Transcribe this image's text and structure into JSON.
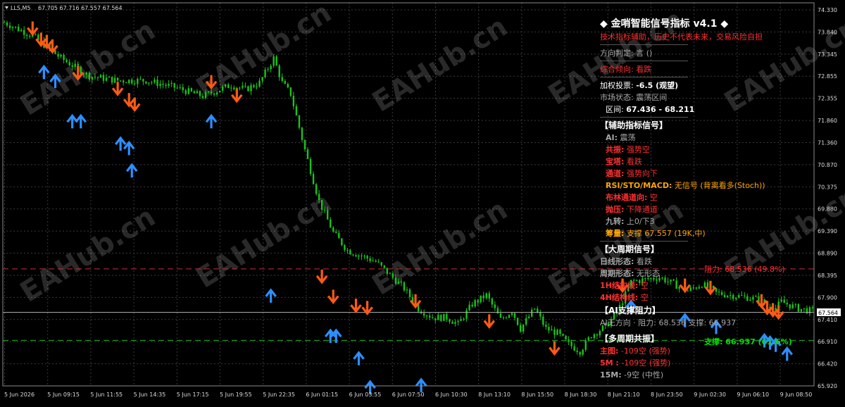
{
  "header": {
    "symbol": "LLS,M5",
    "ohlc": "67.705 67.716 67.557 67.564"
  },
  "price_axis": {
    "ticks": [
      "74.330",
      "73.840",
      "73.345",
      "72.855",
      "72.355",
      "71.860",
      "71.360",
      "70.870",
      "70.375",
      "69.880",
      "69.390",
      "68.890",
      "68.395",
      "67.900",
      "67.410",
      "66.910",
      "66.420",
      "65.920"
    ],
    "current_price": "67.564",
    "current_price_value": 67.564
  },
  "time_axis": {
    "ticks": [
      "5 Jun 2026",
      "5 Jun 09:15",
      "5 Jun 11:55",
      "5 Jun 14:35",
      "5 Jun 17:15",
      "5 Jun 19:55",
      "5 Jun 22:35",
      "6 Jun 01:15",
      "6 Jun 03:55",
      "6 Jun 07:50",
      "6 Jun 10:30",
      "8 Jun 13:10",
      "8 Jun 15:50",
      "8 Jun 18:30",
      "8 Jun 21:10",
      "8 Jun 23:50",
      "9 Jun 02:30",
      "9 Jun 06:10",
      "9 Jun 08:50"
    ]
  },
  "watermark": "EAHub.cn",
  "levels": {
    "resistance_label": "阻力: 68.536 (49.8%)",
    "resistance_value": 68.536,
    "support_label": "支撑: 66.937 (61.6%)",
    "support_value": 66.937
  },
  "colors": {
    "candle": "#19c419",
    "arrow_up": "#2e8fff",
    "arrow_down": "#ff5a14",
    "resistance": "#c83232",
    "support": "#1fb41f",
    "grid": "#3a3a3a"
  },
  "chart_data": {
    "type": "candlestick",
    "ylim": [
      65.92,
      74.33
    ],
    "price_path": [
      [
        0,
        74.05
      ],
      [
        10,
        73.75
      ],
      [
        20,
        73.25
      ],
      [
        30,
        72.85
      ],
      [
        40,
        72.75
      ],
      [
        50,
        72.75
      ],
      [
        60,
        72.6
      ],
      [
        70,
        72.4
      ],
      [
        80,
        72.65
      ],
      [
        85,
        72.55
      ],
      [
        90,
        72.7
      ],
      [
        95,
        73.25
      ],
      [
        98,
        72.7
      ],
      [
        101,
        72.45
      ],
      [
        106,
        71.2
      ],
      [
        111,
        70.05
      ],
      [
        116,
        69.35
      ],
      [
        121,
        68.95
      ],
      [
        131,
        68.7
      ],
      [
        141,
        68.1
      ],
      [
        146,
        67.65
      ],
      [
        151,
        67.45
      ],
      [
        156,
        67.45
      ],
      [
        160,
        67.3
      ],
      [
        165,
        67.75
      ],
      [
        170,
        67.95
      ],
      [
        175,
        67.4
      ],
      [
        179,
        67.6
      ],
      [
        182,
        67.2
      ],
      [
        187,
        67.65
      ],
      [
        191,
        67.2
      ],
      [
        195,
        67.1
      ],
      [
        199,
        66.85
      ],
      [
        203,
        66.7
      ],
      [
        207,
        67.05
      ],
      [
        212,
        67.25
      ],
      [
        216,
        67.55
      ],
      [
        221,
        68.25
      ],
      [
        231,
        68.35
      ],
      [
        241,
        68.05
      ],
      [
        246,
        68.2
      ],
      [
        251,
        68.0
      ],
      [
        256,
        67.95
      ],
      [
        262,
        67.9
      ],
      [
        266,
        67.85
      ],
      [
        271,
        67.6
      ],
      [
        274,
        67.8
      ],
      [
        280,
        67.65
      ],
      [
        285,
        67.59
      ]
    ],
    "signals": [
      {
        "i": 10,
        "dir": "down",
        "price": 73.85
      },
      {
        "i": 13,
        "dir": "down",
        "price": 73.6
      },
      {
        "i": 15,
        "dir": "down",
        "price": 73.55
      },
      {
        "i": 17,
        "dir": "down",
        "price": 73.45
      },
      {
        "i": 14,
        "dir": "up",
        "price": 73.0
      },
      {
        "i": 18,
        "dir": "up",
        "price": 72.8
      },
      {
        "i": 26,
        "dir": "down",
        "price": 72.85
      },
      {
        "i": 24,
        "dir": "up",
        "price": 71.9
      },
      {
        "i": 27,
        "dir": "up",
        "price": 71.9
      },
      {
        "i": 40,
        "dir": "down",
        "price": 72.5
      },
      {
        "i": 44,
        "dir": "down",
        "price": 72.25
      },
      {
        "i": 46,
        "dir": "down",
        "price": 72.15
      },
      {
        "i": 41,
        "dir": "up",
        "price": 71.4
      },
      {
        "i": 44,
        "dir": "up",
        "price": 71.3
      },
      {
        "i": 45,
        "dir": "up",
        "price": 70.8
      },
      {
        "i": 73,
        "dir": "down",
        "price": 72.65
      },
      {
        "i": 82,
        "dir": "down",
        "price": 72.35
      },
      {
        "i": 73,
        "dir": "up",
        "price": 71.9
      },
      {
        "i": 94,
        "dir": "up",
        "price": 68.0
      },
      {
        "i": 112,
        "dir": "down",
        "price": 68.3
      },
      {
        "i": 116,
        "dir": "down",
        "price": 67.85
      },
      {
        "i": 115,
        "dir": "up",
        "price": 67.1
      },
      {
        "i": 117,
        "dir": "up",
        "price": 67.1
      },
      {
        "i": 124,
        "dir": "down",
        "price": 67.65
      },
      {
        "i": 128,
        "dir": "down",
        "price": 67.6
      },
      {
        "i": 125,
        "dir": "up",
        "price": 66.6
      },
      {
        "i": 129,
        "dir": "up",
        "price": 65.95
      },
      {
        "i": 145,
        "dir": "down",
        "price": 67.75
      },
      {
        "i": 147,
        "dir": "up",
        "price": 66.0
      },
      {
        "i": 171,
        "dir": "down",
        "price": 67.3
      },
      {
        "i": 173,
        "dir": "up",
        "price": 65.4
      },
      {
        "i": 194,
        "dir": "down",
        "price": 66.7
      },
      {
        "i": 194,
        "dir": "up",
        "price": 65.35
      },
      {
        "i": 218,
        "dir": "down",
        "price": 68.1
      },
      {
        "i": 221,
        "dir": "up",
        "price": 67.75
      },
      {
        "i": 240,
        "dir": "down",
        "price": 68.1
      },
      {
        "i": 240,
        "dir": "up",
        "price": 67.45
      },
      {
        "i": 249,
        "dir": "down",
        "price": 68.05
      },
      {
        "i": 251,
        "dir": "up",
        "price": 67.3
      },
      {
        "i": 267,
        "dir": "down",
        "price": 67.75
      },
      {
        "i": 269,
        "dir": "down",
        "price": 67.6
      },
      {
        "i": 271,
        "dir": "down",
        "price": 67.55
      },
      {
        "i": 273,
        "dir": "down",
        "price": 67.5
      },
      {
        "i": 268,
        "dir": "up",
        "price": 67.0
      },
      {
        "i": 270,
        "dir": "up",
        "price": 66.95
      },
      {
        "i": 272,
        "dir": "up",
        "price": 66.9
      },
      {
        "i": 276,
        "dir": "up",
        "price": 66.7
      }
    ]
  },
  "panel": {
    "title": "◆ 金哨智能信号指标 v4.1 ◆",
    "disclaimer": "技术指标辅助，历史不代表未来，交易风险自担",
    "direction": {
      "label": "方向判定:",
      "value": "言 ()"
    },
    "overall": {
      "label": "综合倾向:",
      "value": "看跌"
    },
    "weighted": {
      "label": "加权投票:",
      "value": "-6.5 (观望)"
    },
    "market": {
      "label": "市场状态:",
      "value": "震荡区间"
    },
    "range": {
      "label": "区间:",
      "value": "67.436 - 68.211"
    },
    "aux_header": "【辅助指标信号】",
    "aux": [
      {
        "label": "AI:",
        "value": "震荡",
        "color": "gray"
      },
      {
        "label": "共振:",
        "value": "强势空",
        "color": "red"
      },
      {
        "label": "宝塔:",
        "value": "看跌",
        "color": "red"
      },
      {
        "label": "通道:",
        "value": "强势向下",
        "color": "red"
      },
      {
        "label": "RSI/STO/MACD:",
        "value": "无信号 (背离看多(Stoch))",
        "color": "orange"
      },
      {
        "label": "布林通道向:",
        "value": "空",
        "color": "red"
      },
      {
        "label": "抛压:",
        "value": "下降通道",
        "color": "red"
      },
      {
        "label": "九转:",
        "value": "上0/下3",
        "color": "gray"
      },
      {
        "label": "筹量:",
        "value": "支撑 67.557 (19K,中)",
        "color": "orange"
      }
    ],
    "big_header": "【大周期信号】",
    "big": [
      {
        "label": "日线形态:",
        "value": "看跌",
        "color": "gray"
      },
      {
        "label": "周期形态:",
        "value": "无形态",
        "color": "gray"
      },
      {
        "label": "1H结构线:",
        "value": "空",
        "color": "red"
      },
      {
        "label": "4H结构线:",
        "value": "空",
        "color": "red"
      }
    ],
    "ai_header": "【AI支撑阻力】",
    "ai_line": "AI无方向 · 阻力: 68.536   支撑: 66.937",
    "multi_header": "【多周期共振】",
    "multi": [
      {
        "label": "主图:",
        "value": "-109空 (强势)",
        "color": "red"
      },
      {
        "label": "5M :",
        "value": "-109空 (强势)",
        "color": "red"
      },
      {
        "label": "15M:",
        "value": "-9空 (中性)",
        "color": "gray"
      }
    ]
  }
}
